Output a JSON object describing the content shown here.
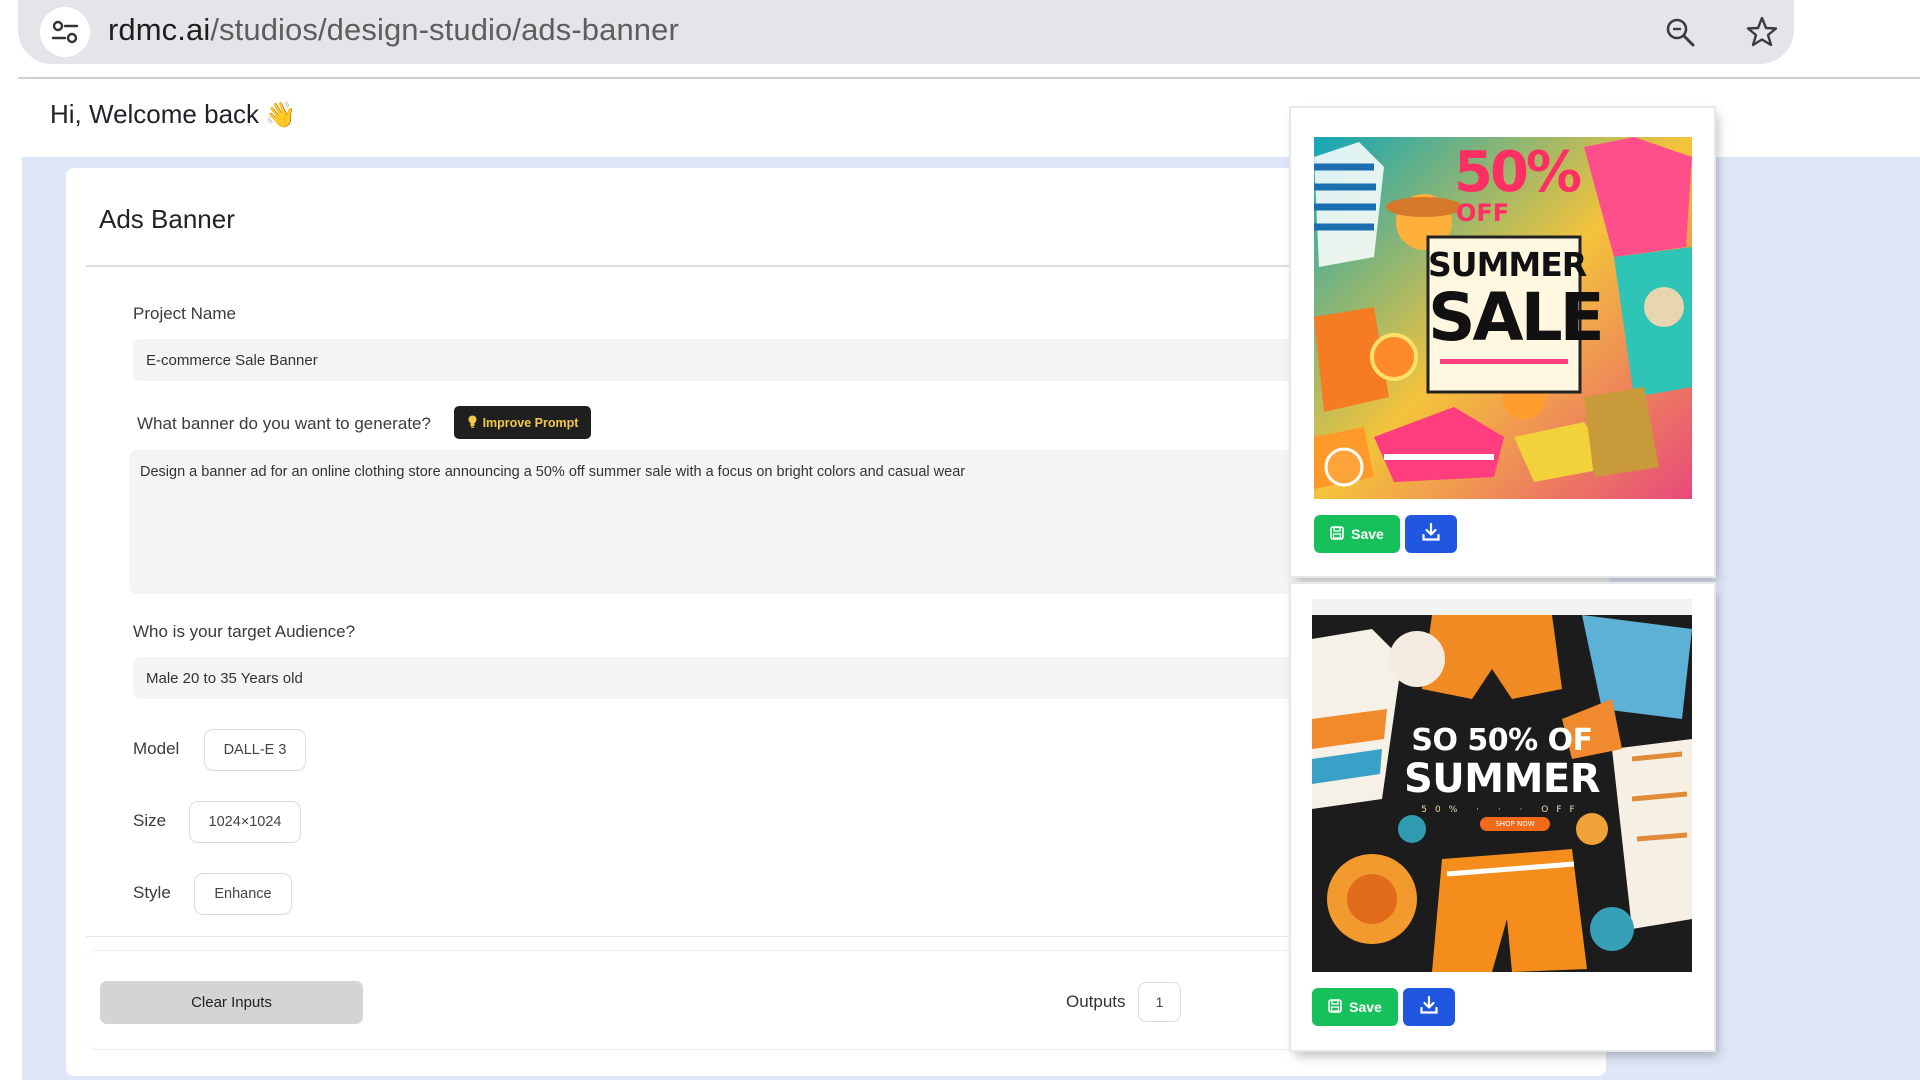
{
  "browser": {
    "url_host": "rdmc.ai",
    "url_path": "/studios/design-studio/ads-banner"
  },
  "header": {
    "welcome": "Hi, Welcome back",
    "wave_emoji": "👋"
  },
  "card": {
    "title": "Ads Banner",
    "project_name_label": "Project Name",
    "project_name_value": "E-commerce Sale Banner",
    "prompt_label": "What banner do you want to generate?",
    "improve_prompt_label": "Improve Prompt",
    "prompt_value": "Design a banner ad for an online clothing store announcing a 50% off summer sale with a focus on bright colors and casual wear",
    "audience_label": "Who is your target Audience?",
    "audience_value": "Male 20 to 35 Years old",
    "model_label": "Model",
    "model_value": "DALL-E 3",
    "size_label": "Size",
    "size_value": "1024×1024",
    "style_label": "Style",
    "style_value": "Enhance",
    "clear_label": "Clear Inputs",
    "outputs_label": "Outputs",
    "outputs_value": "1"
  },
  "results": [
    {
      "banner_line1": "50%",
      "banner_line2": "OFF",
      "banner_line3": "SUMMER",
      "banner_line4": "SALE",
      "save_label": "Save"
    },
    {
      "banner_line1": "SO 50% OF",
      "banner_line2": "SUMMER",
      "banner_line3": "SHOP NOW",
      "banner_line4": "50% · · · OFF",
      "save_label": "Save"
    }
  ],
  "colors": {
    "accent_green": "#16c05a",
    "accent_blue": "#2157e0",
    "page_bg": "#dfe6f7",
    "improve_btn_bg": "#1f1f1f",
    "improve_btn_text": "#f2c84b"
  },
  "icons": [
    "site-info-icon",
    "zoom-icon",
    "star-icon",
    "bulb-icon",
    "save-icon",
    "download-icon"
  ]
}
